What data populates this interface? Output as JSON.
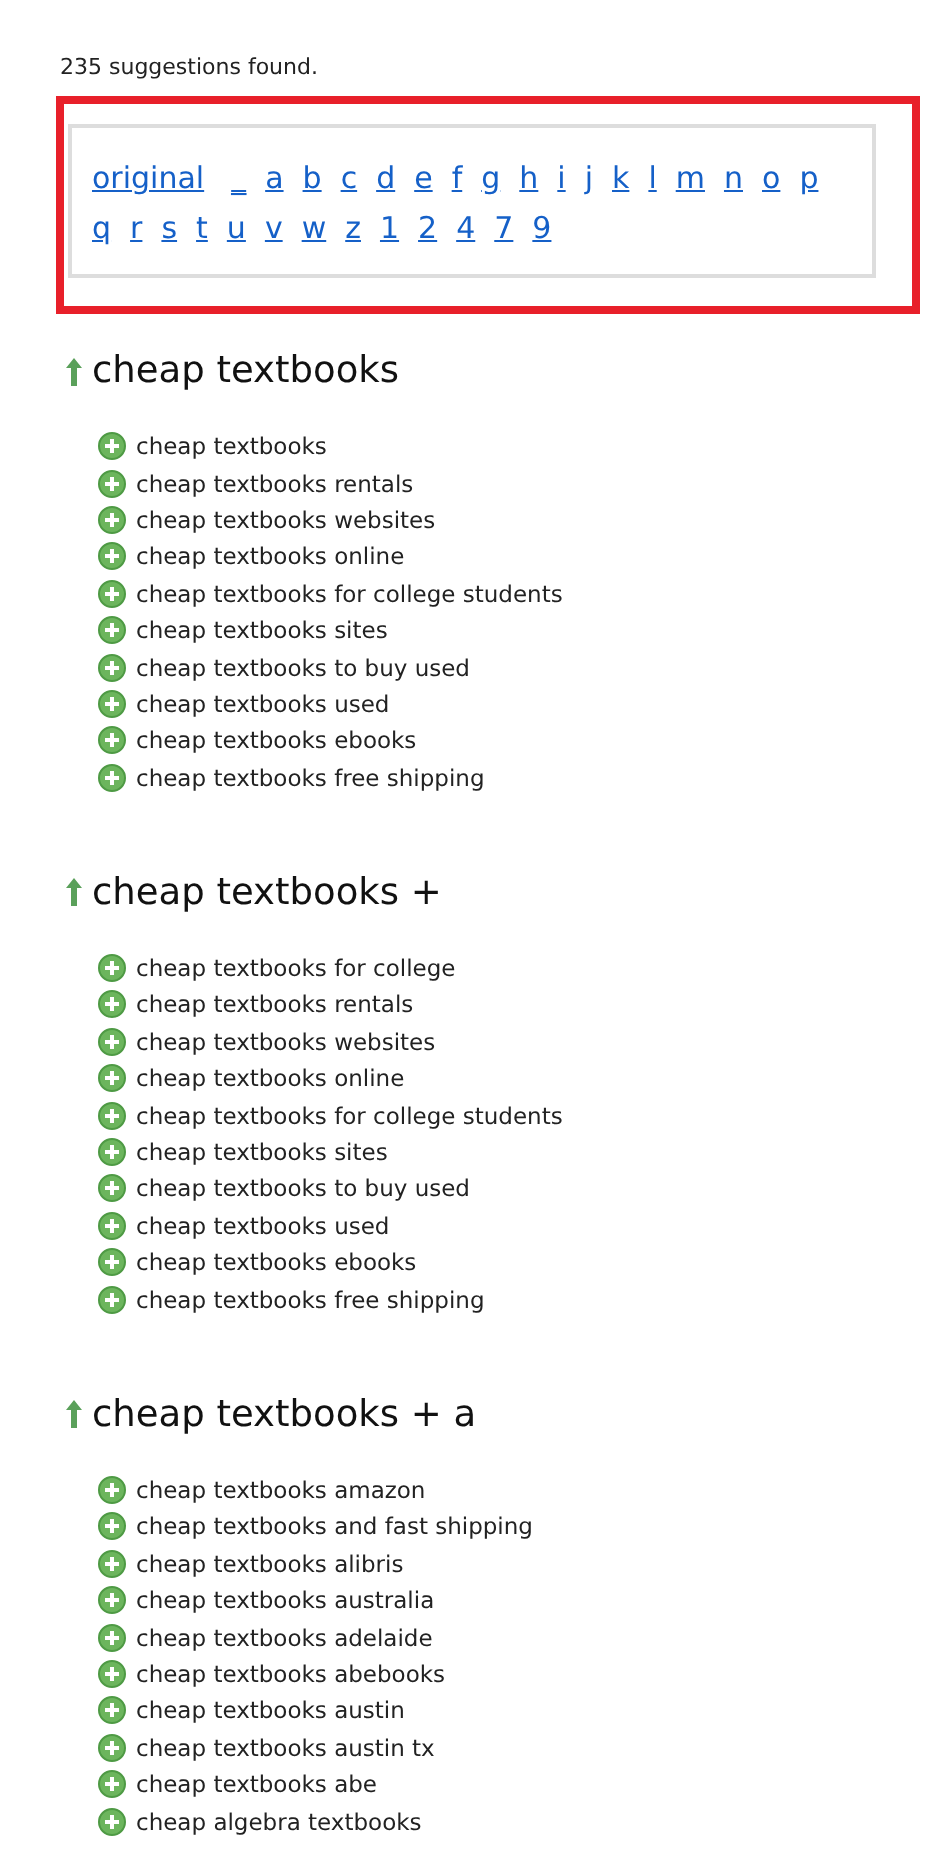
{
  "summary": "235 suggestions found.",
  "index_links": [
    "original",
    "_",
    "a",
    "b",
    "c",
    "d",
    "e",
    "f",
    "g",
    "h",
    "i",
    "j",
    "k",
    "l",
    "m",
    "n",
    "o",
    "p",
    "q",
    "r",
    "s",
    "t",
    "u",
    "v",
    "w",
    "z",
    "1",
    "2",
    "4",
    "7",
    "9"
  ],
  "sections": [
    {
      "heading": "cheap textbooks",
      "suggestions": [
        "cheap textbooks",
        "cheap textbooks rentals",
        "cheap textbooks websites",
        "cheap textbooks online",
        "cheap textbooks for college students",
        "cheap textbooks sites",
        "cheap textbooks to buy used",
        "cheap textbooks used",
        "cheap textbooks ebooks",
        "cheap textbooks free shipping"
      ]
    },
    {
      "heading": "cheap textbooks +",
      "suggestions": [
        "cheap textbooks for college",
        "cheap textbooks rentals",
        "cheap textbooks websites",
        "cheap textbooks online",
        "cheap textbooks for college students",
        "cheap textbooks sites",
        "cheap textbooks to buy used",
        "cheap textbooks used",
        "cheap textbooks ebooks",
        "cheap textbooks free shipping"
      ]
    },
    {
      "heading": "cheap textbooks + a",
      "suggestions": [
        "cheap textbooks amazon",
        "cheap textbooks and fast shipping",
        "cheap textbooks alibris",
        "cheap textbooks australia",
        "cheap textbooks adelaide",
        "cheap textbooks abebooks",
        "cheap textbooks austin",
        "cheap textbooks austin tx",
        "cheap textbooks abe",
        "cheap algebra textbooks"
      ]
    }
  ]
}
